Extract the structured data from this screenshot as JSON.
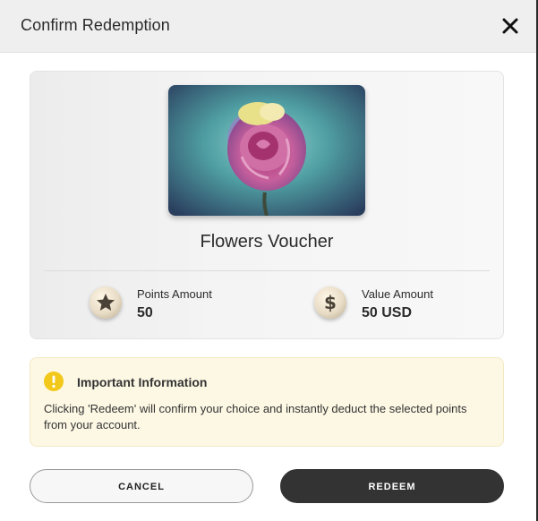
{
  "dialog": {
    "title": "Confirm Redemption",
    "close_icon": "close-icon"
  },
  "voucher": {
    "image_icon": "rose-image",
    "name": "Flowers Voucher",
    "points": {
      "icon": "star-icon",
      "label": "Points Amount",
      "value": "50"
    },
    "value": {
      "icon": "dollar-icon",
      "label": "Value Amount",
      "value": "50 USD"
    }
  },
  "info": {
    "icon": "exclamation-icon",
    "title": "Important Information",
    "text": "Clicking 'Redeem' will confirm your choice and instantly deduct the selected points from your account."
  },
  "actions": {
    "cancel_label": "CANCEL",
    "redeem_label": "REDEEM"
  },
  "colors": {
    "header_bg": "#efefef",
    "info_bg": "#fdf8e4",
    "info_icon": "#f2c91a",
    "primary_button": "#333333"
  }
}
